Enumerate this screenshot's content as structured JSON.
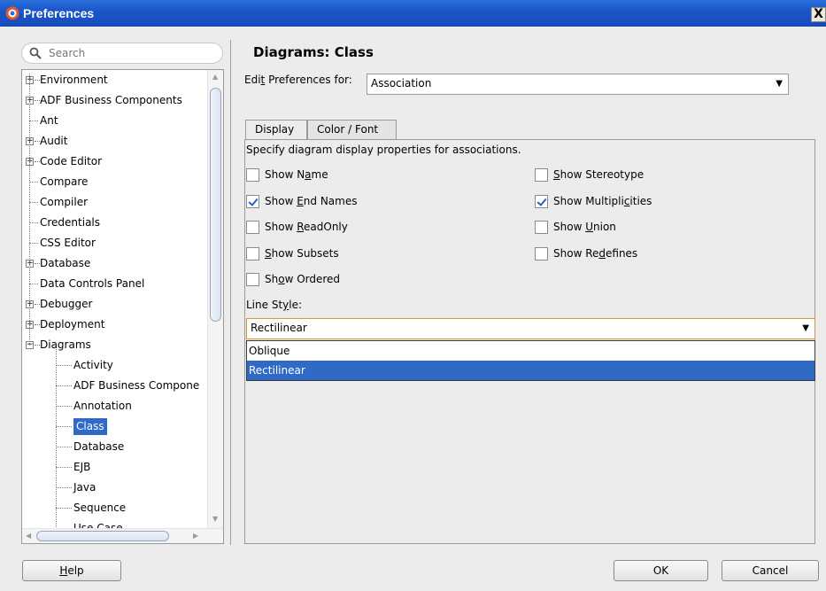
{
  "window": {
    "title": "Preferences",
    "close_label": "X"
  },
  "search": {
    "placeholder": "Search"
  },
  "tree": {
    "items": [
      {
        "label": "Environment",
        "expandable": true,
        "expanded": false,
        "level": 0
      },
      {
        "label": "ADF Business Components",
        "expandable": true,
        "expanded": false,
        "level": 0
      },
      {
        "label": "Ant",
        "expandable": false,
        "level": 0
      },
      {
        "label": "Audit",
        "expandable": true,
        "expanded": false,
        "level": 0
      },
      {
        "label": "Code Editor",
        "expandable": true,
        "expanded": false,
        "level": 0
      },
      {
        "label": "Compare",
        "expandable": false,
        "level": 0
      },
      {
        "label": "Compiler",
        "expandable": false,
        "level": 0
      },
      {
        "label": "Credentials",
        "expandable": false,
        "level": 0
      },
      {
        "label": "CSS Editor",
        "expandable": false,
        "level": 0
      },
      {
        "label": "Database",
        "expandable": true,
        "expanded": false,
        "level": 0
      },
      {
        "label": "Data Controls Panel",
        "expandable": false,
        "level": 0
      },
      {
        "label": "Debugger",
        "expandable": true,
        "expanded": false,
        "level": 0
      },
      {
        "label": "Deployment",
        "expandable": true,
        "expanded": false,
        "level": 0
      },
      {
        "label": "Diagrams",
        "expandable": true,
        "expanded": true,
        "level": 0
      },
      {
        "label": "Activity",
        "expandable": false,
        "level": 1
      },
      {
        "label": "ADF Business Compone",
        "expandable": false,
        "level": 1
      },
      {
        "label": "Annotation",
        "expandable": false,
        "level": 1
      },
      {
        "label": "Class",
        "expandable": false,
        "level": 1,
        "selected": true
      },
      {
        "label": "Database",
        "expandable": false,
        "level": 1
      },
      {
        "label": "EJB",
        "expandable": false,
        "level": 1
      },
      {
        "label": "Java",
        "expandable": false,
        "level": 1
      },
      {
        "label": "Sequence",
        "expandable": false,
        "level": 1
      },
      {
        "label": "Use Case",
        "expandable": false,
        "level": 1
      }
    ]
  },
  "page": {
    "title": "Diagrams: Class",
    "edit_for_label_pre": "Edi",
    "edit_for_label_u": "t",
    "edit_for_label_post": " Preferences for:",
    "edit_for_value": "Association"
  },
  "tabs": {
    "display": "Display",
    "color_font": "Color / Font"
  },
  "display": {
    "description": "Specify diagram display properties for associations.",
    "checkboxes": {
      "show_name": {
        "pre": "Show N",
        "u": "a",
        "post": "me",
        "checked": false
      },
      "show_stereotype": {
        "pre": "",
        "u": "S",
        "post": "how Stereotype",
        "checked": false
      },
      "show_end_names": {
        "pre": "Show ",
        "u": "E",
        "post": "nd Names",
        "checked": true
      },
      "show_multiplicities": {
        "pre": "Show Multipli",
        "u": "c",
        "post": "ities",
        "checked": true
      },
      "show_readonly": {
        "pre": "Show ",
        "u": "R",
        "post": "eadOnly",
        "checked": false
      },
      "show_union": {
        "pre": "Show ",
        "u": "U",
        "post": "nion",
        "checked": false
      },
      "show_subsets": {
        "pre": "",
        "u": "S",
        "post": "how Subsets",
        "checked": false
      },
      "show_redefines": {
        "pre": "Show Re",
        "u": "d",
        "post": "efines",
        "checked": false
      },
      "show_ordered": {
        "pre": "Sh",
        "u": "o",
        "post": "w Ordered",
        "checked": false
      }
    },
    "line_style_label_pre": "Line St",
    "line_style_label_u": "y",
    "line_style_label_post": "le:",
    "line_style_value": "Rectilinear",
    "line_style_options": [
      "Oblique",
      "Rectilinear"
    ],
    "line_style_selected_index": 1
  },
  "buttons": {
    "help_u": "H",
    "help_rest": "elp",
    "ok": "OK",
    "cancel": "Cancel"
  },
  "colors": {
    "titlebar": "#1a56c8",
    "selection": "#3169c6"
  }
}
